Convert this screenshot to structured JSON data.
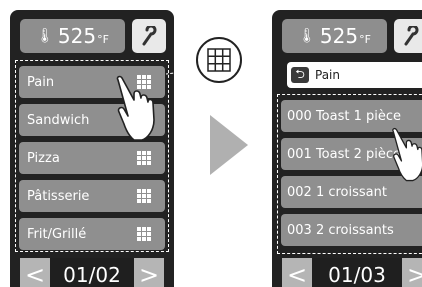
{
  "left_screen": {
    "temperature": "525",
    "temperature_unit": "°F",
    "menu_items": [
      "Pain",
      "Sandwich",
      "Pizza",
      "Pâtisserie",
      "Frit/Grillé"
    ],
    "page_indicator": "01/02",
    "prev_arrow": "<",
    "next_arrow": ">"
  },
  "right_screen": {
    "temperature": "525",
    "temperature_unit": "°F",
    "breadcrumb": "Pain",
    "menu_items": [
      "000 Toast 1 pièce",
      "001 Toast 2 pièces",
      "002 1 croissant",
      "003 2 croissants"
    ],
    "page_indicator": "01/03",
    "prev_arrow": "<",
    "next_arrow": ">"
  },
  "icons": {
    "thermometer": "thermometer-icon",
    "wrench": "wrench-icon",
    "grid": "grid-icon",
    "back": "back-icon",
    "hand": "hand-pointer-icon",
    "transition": "right-arrow-icon"
  },
  "colors": {
    "panel_bg": "#222222",
    "item_bg": "#8f8f8f",
    "temp_bg": "#8e8e8e",
    "pager_bg": "#b5b5b5",
    "arrow": "#b0b0b0"
  }
}
